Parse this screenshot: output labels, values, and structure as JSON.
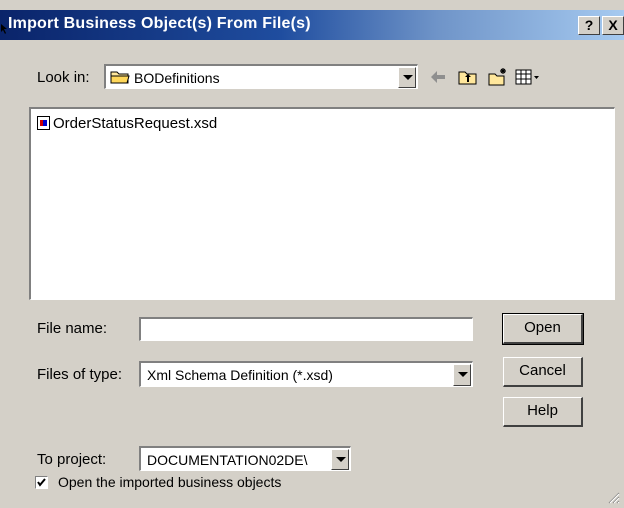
{
  "window": {
    "title": "Import Business Object(s) From File(s)",
    "help_button": "?",
    "close_button": "X"
  },
  "look_in": {
    "label": "Look in:",
    "value": "BODefinitions"
  },
  "toolbar": {
    "icons": [
      "back-arrow-icon",
      "up-folder-icon",
      "new-folder-icon",
      "view-menu-icon"
    ]
  },
  "file_list": {
    "items": [
      {
        "name": "OrderStatusRequest.xsd",
        "icon": "xsd-file-icon"
      }
    ]
  },
  "file_name": {
    "label": "File name:",
    "value": ""
  },
  "files_of_type": {
    "label": "Files of type:",
    "value": "Xml Schema Definition (*.xsd)"
  },
  "buttons": {
    "open": "Open",
    "cancel": "Cancel",
    "help": "Help"
  },
  "to_project": {
    "label": "To project:",
    "value": "DOCUMENTATION02DE\\"
  },
  "open_imported": {
    "label": "Open the imported business objects",
    "checked": true
  },
  "colors": {
    "title_bar_start": "#0a246a",
    "title_bar_end": "#a6caf0",
    "dialog_face": "#d4d0c8"
  }
}
